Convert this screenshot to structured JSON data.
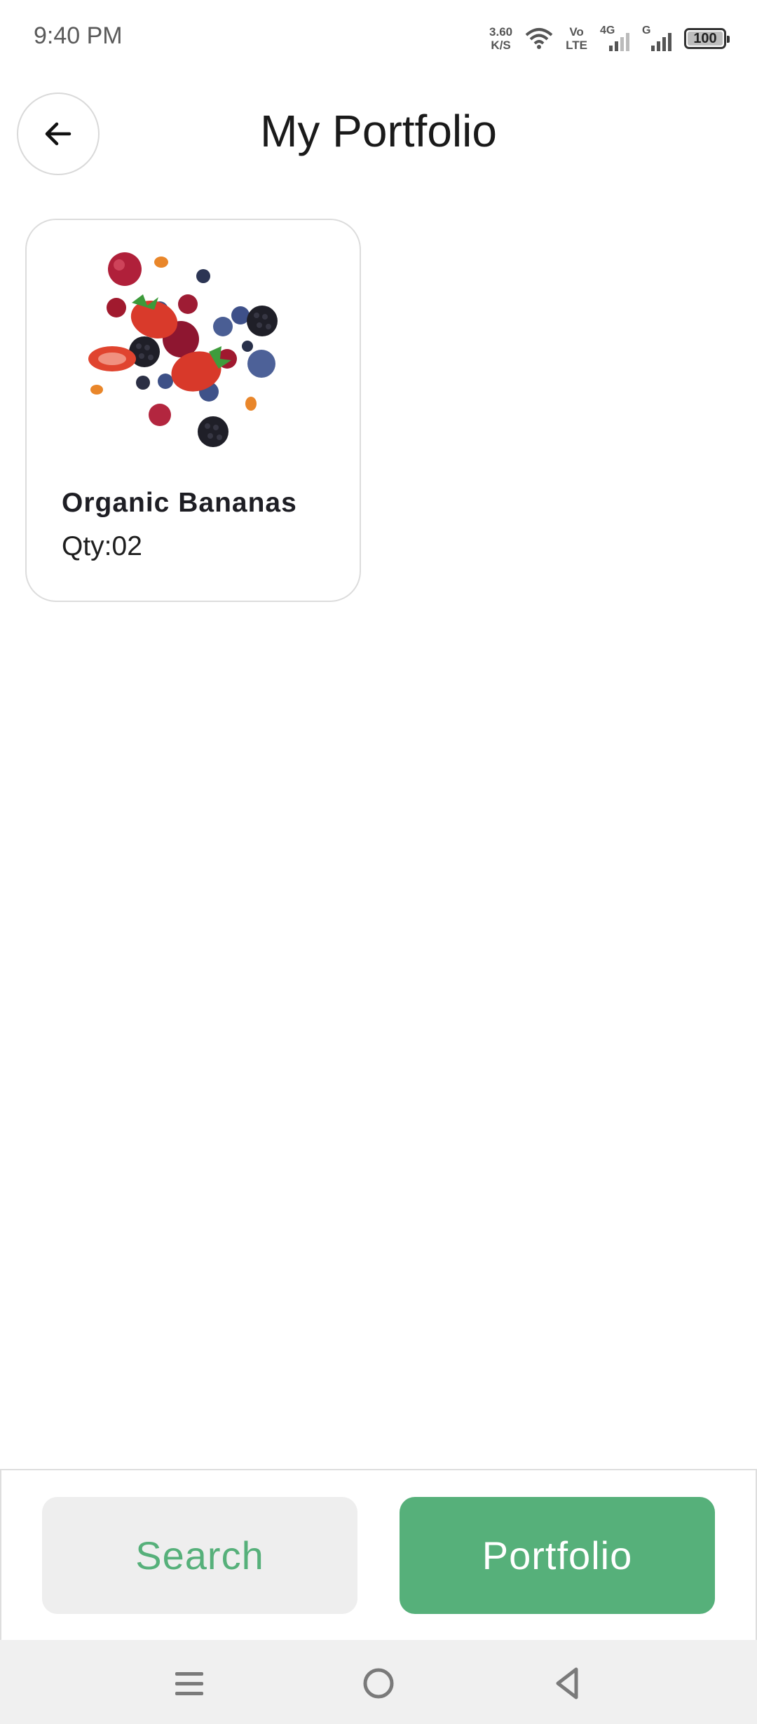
{
  "status_bar": {
    "time": "9:40 PM",
    "net_speed_value": "3.60",
    "net_speed_unit": "K/S",
    "volte_top": "Vo",
    "volte_bottom": "LTE",
    "sim1_label": "4G",
    "sim2_label": "G",
    "battery": "100"
  },
  "header": {
    "back_icon": "arrow-left-icon",
    "title": "My Portfolio"
  },
  "portfolio": {
    "items": [
      {
        "name": "Organic Bananas",
        "qty": "Qty:02",
        "image": "mixed-berries-image"
      }
    ]
  },
  "bottom_bar": {
    "search_label": "Search",
    "portfolio_label": "Portfolio",
    "accent_color": "#56b07a"
  },
  "system_nav": {
    "menu_icon": "menu-icon",
    "home_icon": "home-circle-icon",
    "back_icon": "back-triangle-icon"
  }
}
